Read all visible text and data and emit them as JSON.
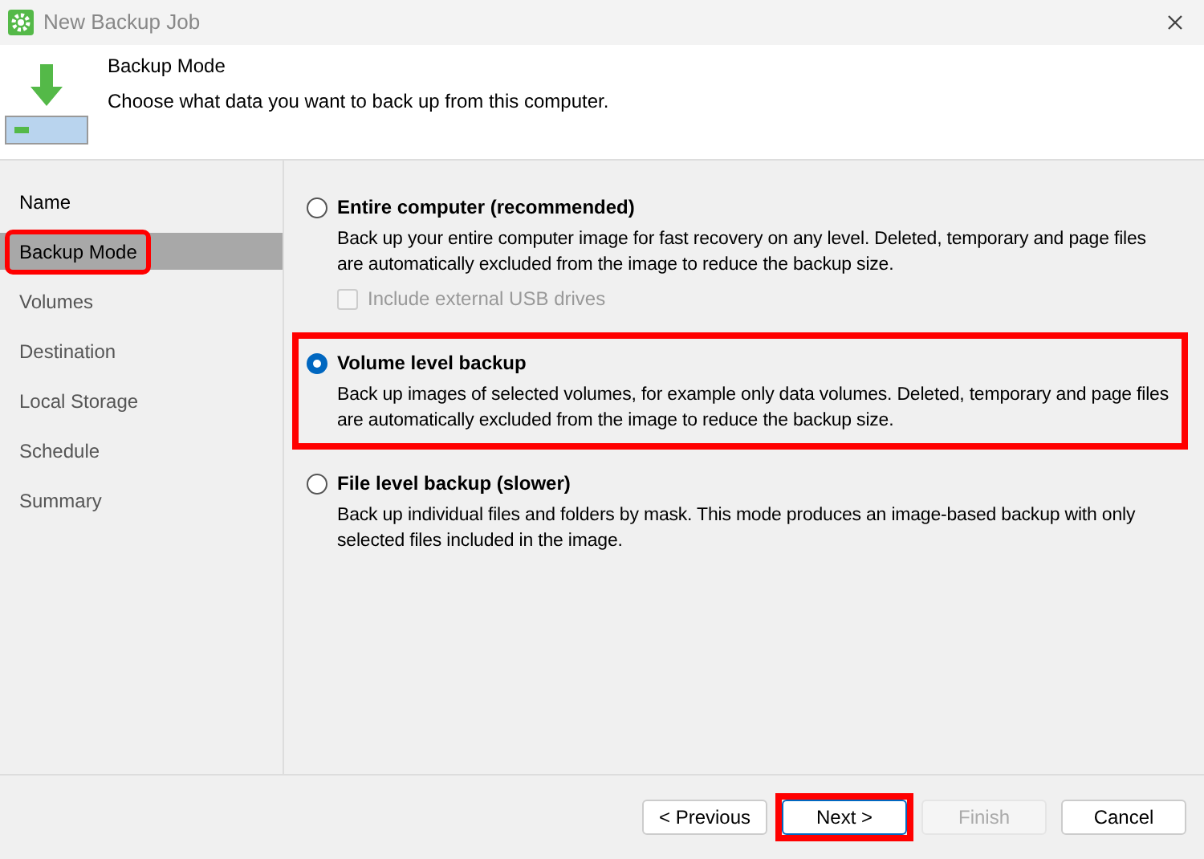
{
  "window": {
    "title": "New Backup Job"
  },
  "header": {
    "title": "Backup Mode",
    "subtitle": "Choose what data you want to back up from this computer."
  },
  "sidebar": {
    "items": [
      {
        "label": "Name",
        "selected": false,
        "enabled": true,
        "highlighted": false
      },
      {
        "label": "Backup Mode",
        "selected": true,
        "enabled": true,
        "highlighted": true
      },
      {
        "label": "Volumes",
        "selected": false,
        "enabled": false,
        "highlighted": false
      },
      {
        "label": "Destination",
        "selected": false,
        "enabled": false,
        "highlighted": false
      },
      {
        "label": "Local Storage",
        "selected": false,
        "enabled": false,
        "highlighted": false
      },
      {
        "label": "Schedule",
        "selected": false,
        "enabled": false,
        "highlighted": false
      },
      {
        "label": "Summary",
        "selected": false,
        "enabled": false,
        "highlighted": false
      }
    ]
  },
  "options": [
    {
      "label": "Entire computer (recommended)",
      "description": "Back up your entire computer image for fast recovery on any level. Deleted, temporary and page files are automatically excluded from the image to reduce the backup size.",
      "selected": false,
      "highlighted": false,
      "checkbox": {
        "label": "Include external USB drives",
        "checked": false,
        "disabled": true
      }
    },
    {
      "label": "Volume level backup",
      "description": "Back up images of selected volumes, for example only data volumes. Deleted, temporary and page files are automatically excluded from the image to reduce the backup size.",
      "selected": true,
      "highlighted": true
    },
    {
      "label": "File level backup (slower)",
      "description": "Back up individual files and folders by mask. This mode produces an image-based backup with only selected files included in the image.",
      "selected": false,
      "highlighted": false
    }
  ],
  "buttons": [
    {
      "label": "< Previous",
      "disabled": false,
      "focused": false,
      "highlighted": false
    },
    {
      "label": "Next >",
      "disabled": false,
      "focused": true,
      "highlighted": true
    },
    {
      "label": "Finish",
      "disabled": true,
      "focused": false,
      "highlighted": false
    },
    {
      "label": "Cancel",
      "disabled": false,
      "focused": false,
      "highlighted": false
    }
  ]
}
